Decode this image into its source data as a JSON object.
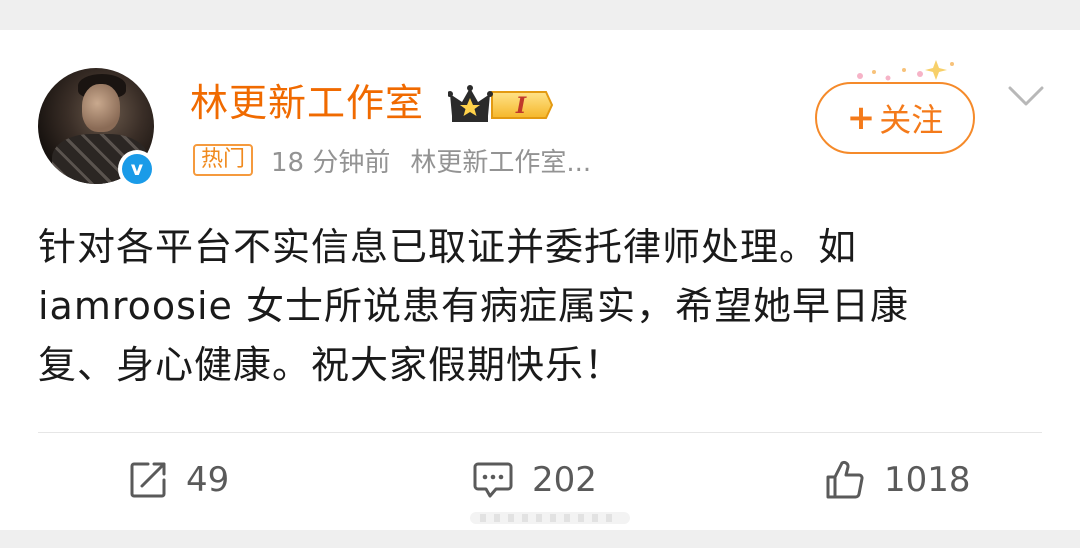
{
  "post": {
    "username": "林更新工作室",
    "hot_tag": "热门",
    "time": "18 分钟前",
    "source": "林更新工作室...",
    "text_lines": [
      "针对各平台不实信息已取证并委托律师处理。如",
      "iamroosie 女士所说患有病症属实，希望她早日康",
      "复、身心健康。祝大家假期快乐！"
    ]
  },
  "follow": {
    "plus": "+",
    "label": "关注"
  },
  "badge": {
    "level": "I"
  },
  "verified": {
    "mark": "v"
  },
  "actions": {
    "repost_count": "49",
    "comment_count": "202",
    "like_count": "1018"
  },
  "colors": {
    "username": "#f06a00",
    "accent": "#f58a2a",
    "verified": "#1a9be8",
    "meta": "#939393",
    "text": "#1a1a1a"
  }
}
